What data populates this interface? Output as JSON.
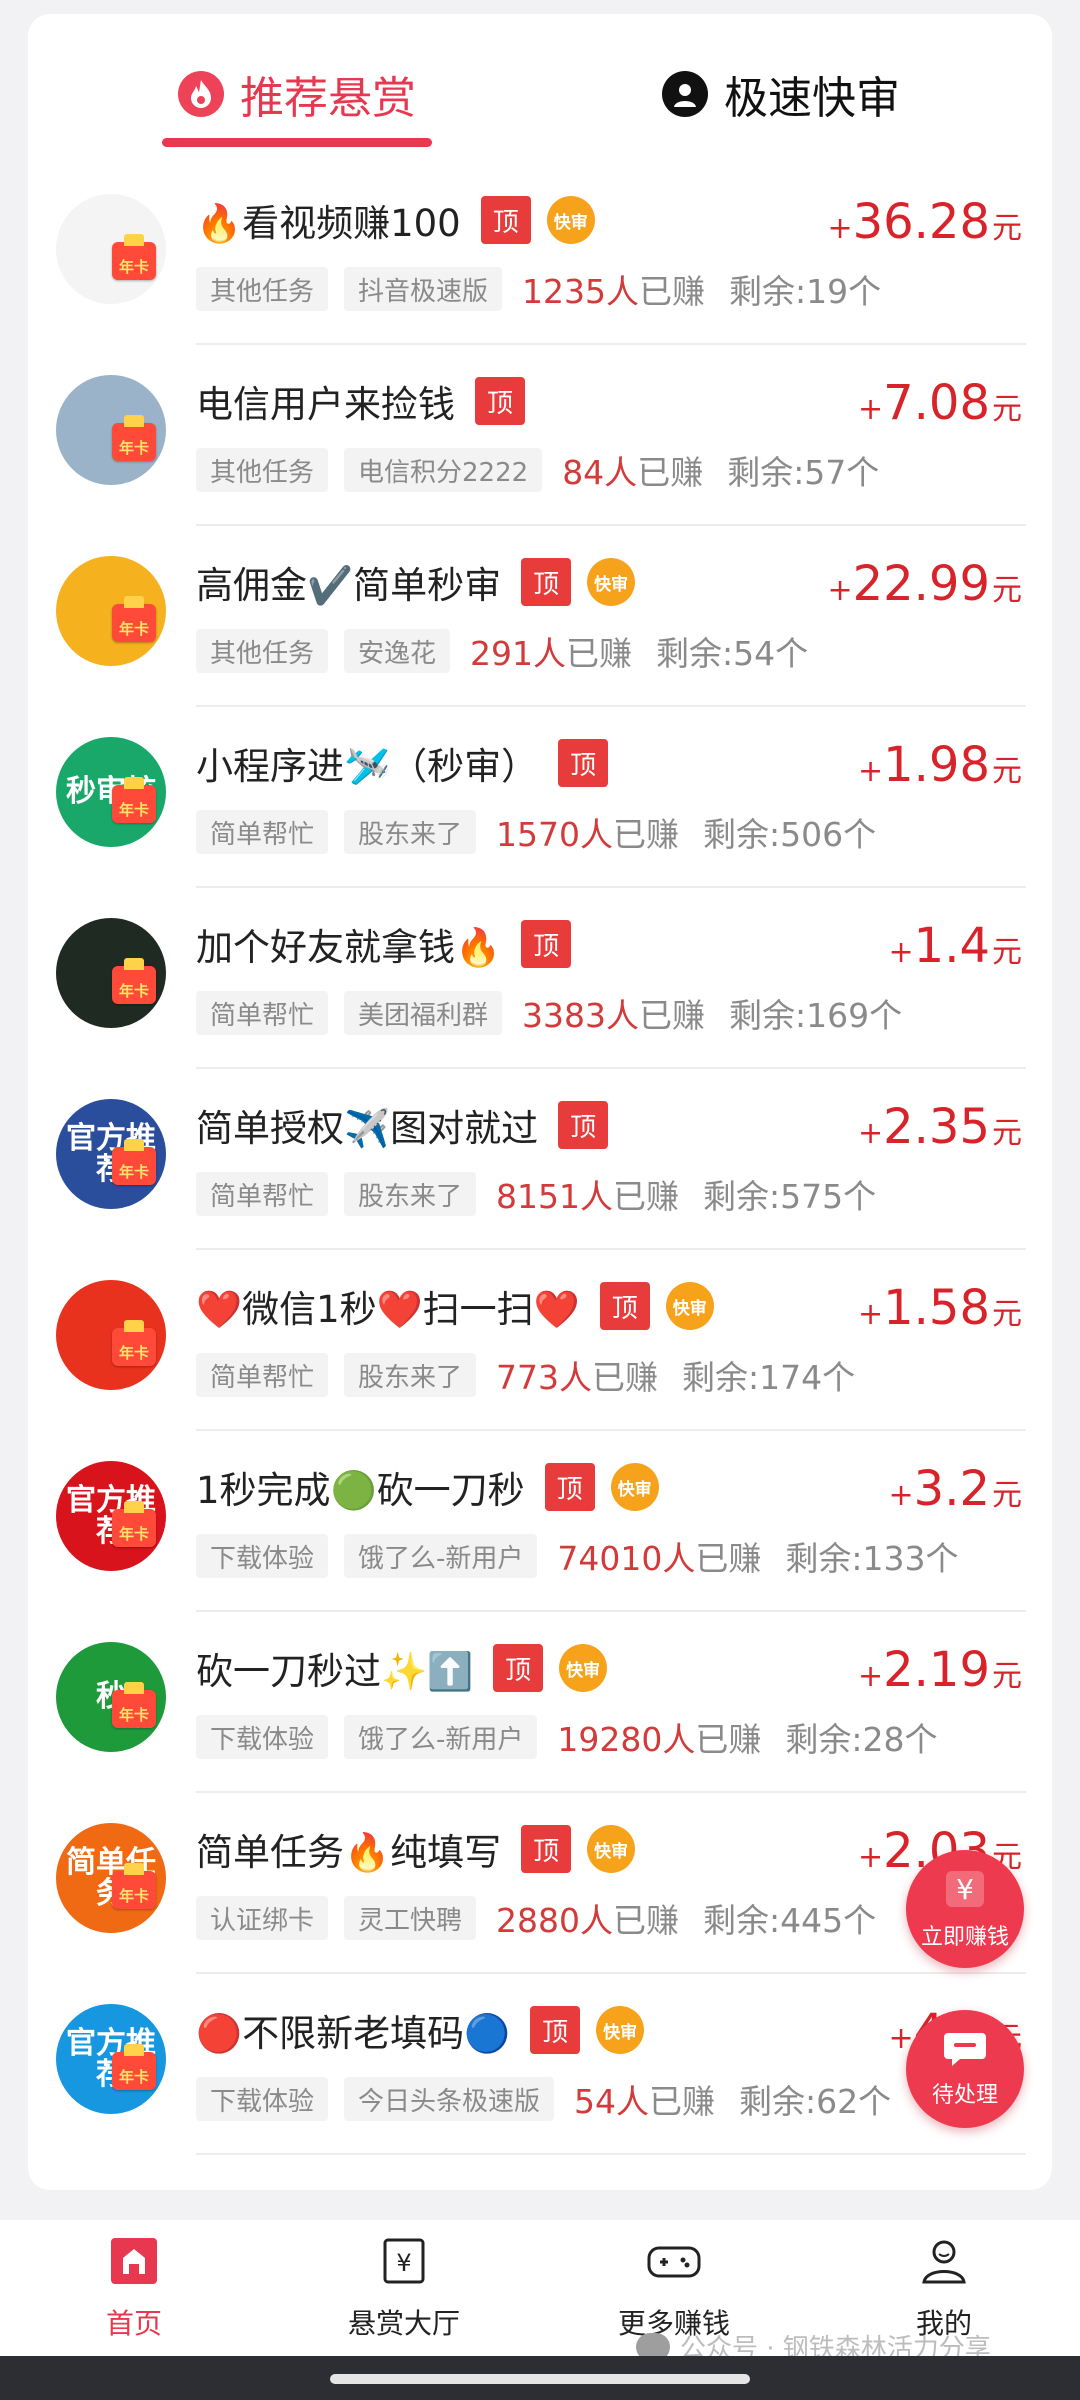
{
  "tabs": {
    "recommended": "推荐悬赏",
    "fast_review": "极速快审"
  },
  "tags": {
    "top": "顶",
    "fast": "快审",
    "badge": "年卡"
  },
  "price_unit": "元",
  "earned_suffix": "已赚",
  "tasks": [
    {
      "title": "🔥看视频赚100",
      "top": true,
      "fast": true,
      "cat": "其他任务",
      "source": "抖音极速版",
      "earned": "1235人",
      "remain": "剩余:19个",
      "price": "36.28",
      "avatar": {
        "text": "",
        "color": "#f4f4f4"
      }
    },
    {
      "title": "电信用户来捡钱",
      "top": true,
      "fast": false,
      "cat": "其他任务",
      "source": "电信积分2222",
      "earned": "84人",
      "remain": "剩余:57个",
      "price": "7.08",
      "avatar": {
        "text": "",
        "color": "#9bb3c9"
      }
    },
    {
      "title": "高佣金✔️简单秒审",
      "top": true,
      "fast": true,
      "cat": "其他任务",
      "source": "安逸花",
      "earned": "291人",
      "remain": "剩余:54个",
      "price": "22.99",
      "avatar": {
        "text": "",
        "color": "#f5b21e"
      }
    },
    {
      "title": "小程序进🛩️（秒审）",
      "top": true,
      "fast": false,
      "cat": "简单帮忙",
      "source": "股东来了",
      "earned": "1570人",
      "remain": "剩余:506个",
      "price": "1.98",
      "avatar": {
        "text": "秒审核",
        "color": "#1aa86a"
      }
    },
    {
      "title": "加个好友就拿钱🔥",
      "top": true,
      "fast": false,
      "cat": "简单帮忙",
      "source": "美团福利群",
      "earned": "3383人",
      "remain": "剩余:169个",
      "price": "1.4",
      "avatar": {
        "text": "",
        "color": "#1f2b22"
      }
    },
    {
      "title": "简单授权✈️图对就过",
      "top": true,
      "fast": false,
      "cat": "简单帮忙",
      "source": "股东来了",
      "earned": "8151人",
      "remain": "剩余:575个",
      "price": "2.35",
      "avatar": {
        "text": "官方推荐",
        "color": "#2a4d9c"
      }
    },
    {
      "title": "❤️微信1秒❤️扫一扫❤️",
      "top": true,
      "fast": true,
      "cat": "简单帮忙",
      "source": "股东来了",
      "earned": "773人",
      "remain": "剩余:174个",
      "price": "1.58",
      "avatar": {
        "text": "",
        "color": "#e8321e"
      }
    },
    {
      "title": "1秒完成🟢砍一刀秒",
      "top": true,
      "fast": true,
      "cat": "下载体验",
      "source": "饿了么-新用户",
      "earned": "74010人",
      "remain": "剩余:133个",
      "price": "3.2",
      "avatar": {
        "text": "官方推荐",
        "color": "#d8131c"
      }
    },
    {
      "title": "砍一刀秒过✨⬆️",
      "top": true,
      "fast": true,
      "cat": "下载体验",
      "source": "饿了么-新用户",
      "earned": "19280人",
      "remain": "剩余:28个",
      "price": "2.19",
      "avatar": {
        "text": "秒",
        "color": "#1e9a3a"
      }
    },
    {
      "title": "简单任务🔥纯填写",
      "top": true,
      "fast": true,
      "cat": "认证绑卡",
      "source": "灵工快聘",
      "earned": "2880人",
      "remain": "剩余:445个",
      "price": "2.03",
      "avatar": {
        "text": "简单任务",
        "color": "#f06a14"
      }
    },
    {
      "title": "🔴不限新老填码🔵",
      "top": true,
      "fast": true,
      "cat": "下载体验",
      "source": "今日头条极速版",
      "earned": "54人",
      "remain": "剩余:62个",
      "price": "4.3",
      "avatar": {
        "text": "官方推荐",
        "color": "#1797e0"
      }
    }
  ],
  "floats": {
    "earn_now": "立即赚钱",
    "pending": "待处理"
  },
  "nav": {
    "home": "首页",
    "hall": "悬赏大厅",
    "more": "更多赚钱",
    "me": "我的"
  },
  "watermark": "公众号 · 钢铁森林活力分享",
  "colors": {
    "accent": "#e8384f",
    "price": "#d8232a",
    "top_tag": "#e83c3c",
    "fast_tag": "#f7a21b"
  }
}
